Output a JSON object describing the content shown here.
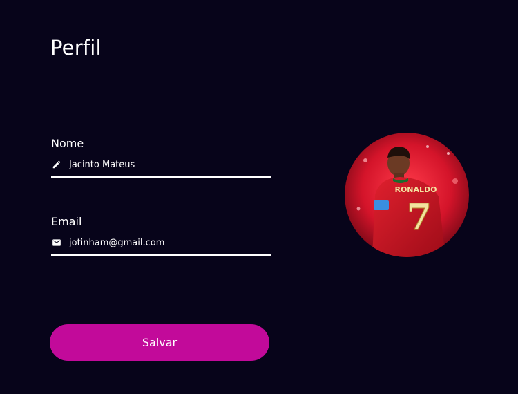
{
  "page": {
    "title": "Perfil"
  },
  "form": {
    "name": {
      "label": "Nome",
      "value": "Jacinto Mateus",
      "icon": "pencil-icon"
    },
    "email": {
      "label": "Email",
      "value": "jotinham@gmail.com",
      "icon": "mail-icon"
    },
    "save_label": "Salvar"
  },
  "avatar": {
    "jersey_name": "RONALDO",
    "jersey_number": "7"
  },
  "colors": {
    "background": "#07041a",
    "accent": "#c20a9a",
    "text": "#ffffff"
  }
}
